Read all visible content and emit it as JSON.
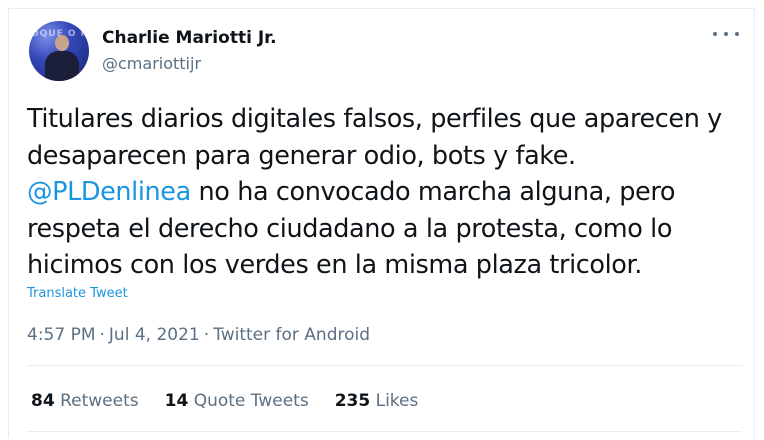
{
  "author": {
    "display_name": "Charlie Mariotti Jr.",
    "handle": "@cmariottijr",
    "avatar_overlay_text": "OQUE O MEDIN"
  },
  "tweet": {
    "text_before_mention": "Titulares diarios digitales falsos, perfiles que aparecen y desaparecen para generar odio, bots y fake. ",
    "mention": "@PLDenlinea",
    "text_after_mention": " no ha convocado marcha alguna, pero respeta el derecho ciudadano a la protesta, como lo hicimos con los verdes en la misma plaza tricolor.",
    "translate_label": "Translate Tweet"
  },
  "meta": {
    "time": "4:57 PM",
    "separator": "·",
    "date": "Jul 4, 2021",
    "source": "Twitter for Android"
  },
  "stats": {
    "retweets_count": "84",
    "retweets_label": "Retweets",
    "quote_tweets_count": "14",
    "quote_tweets_label": "Quote Tweets",
    "likes_count": "235",
    "likes_label": "Likes"
  },
  "icons": {
    "more": "more-horizontal-icon"
  },
  "colors": {
    "link": "#1b95e0",
    "secondary_text": "#5b7083",
    "primary_text": "#0f1419",
    "border": "#e6ecf0"
  }
}
